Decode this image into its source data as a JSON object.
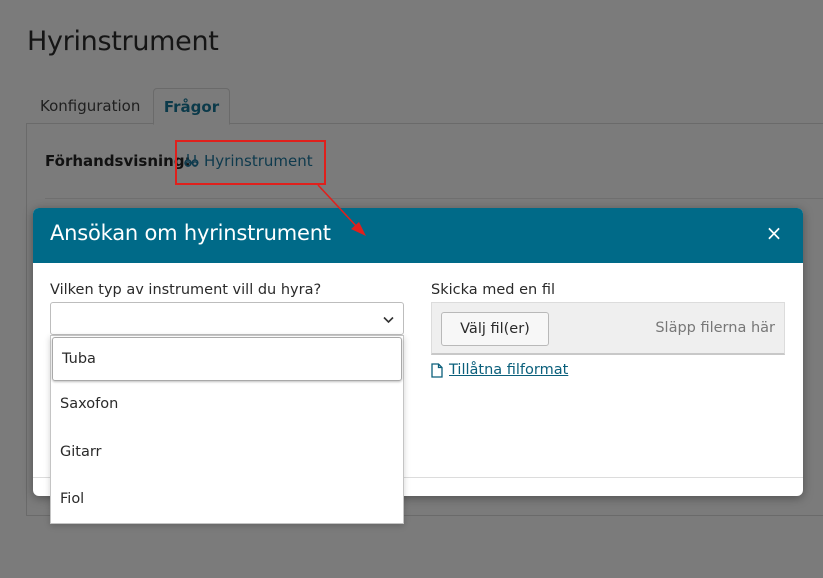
{
  "page": {
    "title": "Hyrinstrument"
  },
  "tabs": [
    {
      "label": "Konfiguration"
    },
    {
      "label": "Frågor"
    }
  ],
  "preview": {
    "label": "Förhandsvisning:",
    "link": "Hyrinstrument",
    "icon": "musical-instrument-icon"
  },
  "annotation_color": "#e0201c",
  "modal": {
    "title": "Ansökan om hyrinstrument",
    "close": "×",
    "header_color": "#006a88",
    "question_label": "Vilken typ av instrument vill du hyra?",
    "select_value": "",
    "options": [
      "Tuba",
      "Saxofon",
      "Gitarr",
      "Fiol"
    ],
    "file_label": "Skicka med en fil",
    "choose_files": "Välj fil(er)",
    "drop_hint": "Släpp filerna här",
    "formats_link": "Tillåtna filformat"
  }
}
